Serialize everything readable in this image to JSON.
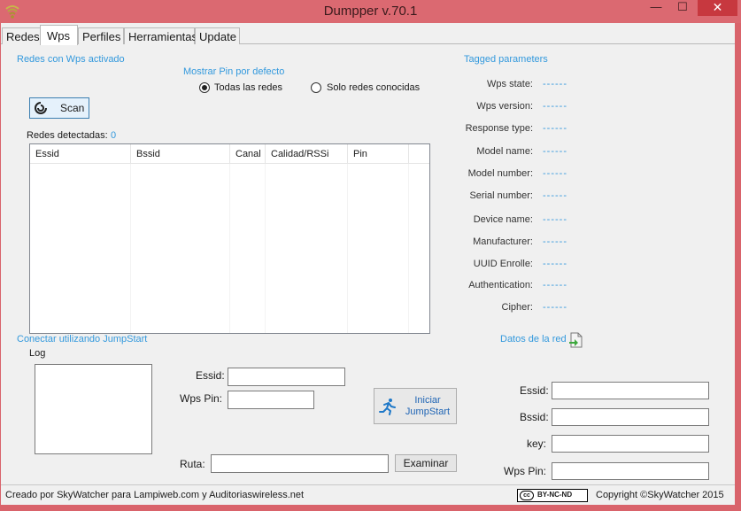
{
  "window": {
    "title": "Dumpper v.70.1",
    "min_glyph": "—",
    "max_glyph": "☐",
    "close_glyph": "✕"
  },
  "tabs": [
    {
      "label": "Redes"
    },
    {
      "label": "Wps",
      "active": true
    },
    {
      "label": "Perfiles"
    },
    {
      "label": "Herramientas"
    },
    {
      "label": "Update"
    }
  ],
  "wps": {
    "section_title": "Redes con Wps activado",
    "scan_label": "Scan",
    "pin_group_title": "Mostrar Pin por defecto",
    "radio_all": "Todas las redes",
    "radio_known": "Solo redes conocidas",
    "radio_selected": "all",
    "detected_label": "Redes detectadas:",
    "detected_count": "0",
    "columns": [
      "Essid",
      "Bssid",
      "Canal",
      "Calidad/RSSi",
      "Pin"
    ]
  },
  "tagged": {
    "title": "Tagged parameters",
    "params": [
      {
        "label": "Wps state:",
        "value": "------"
      },
      {
        "label": "Wps version:",
        "value": "------"
      },
      {
        "label": "Response type:",
        "value": "------"
      },
      {
        "label": "Model name:",
        "value": "------"
      },
      {
        "label": "Model number:",
        "value": "------"
      },
      {
        "label": "Serial number:",
        "value": "------"
      },
      {
        "label": "Device name:",
        "value": "------"
      },
      {
        "label": "Manufacturer:",
        "value": "------"
      },
      {
        "label": "UUID Enrolle:",
        "value": "------"
      },
      {
        "label": "Authentication:",
        "value": "------"
      },
      {
        "label": "Cipher:",
        "value": "------"
      }
    ]
  },
  "jumpstart": {
    "title": "Conectar utilizando JumpStart",
    "log_label": "Log",
    "essid_label": "Essid:",
    "essid_value": "",
    "wpspin_label": "Wps Pin:",
    "wpspin_value": "",
    "button_line1": "Iniciar",
    "button_line2": "JumpStart",
    "ruta_label": "Ruta:",
    "ruta_value": "",
    "examinar_label": "Examinar"
  },
  "red_data": {
    "title": "Datos de la red",
    "essid_label": "Essid:",
    "bssid_label": "Bssid:",
    "key_label": "key:",
    "wpspin_label": "Wps Pin:"
  },
  "status": {
    "left": "Creado por SkyWatcher para Lampiweb.com y Auditoriaswireless.net",
    "license_badge": "BY-NC-ND",
    "right": "Copyright ©SkyWatcher 2015"
  },
  "colors": {
    "accent_blue": "#3399dd",
    "titlebar": "#db6971",
    "close_button": "#c7383f"
  }
}
